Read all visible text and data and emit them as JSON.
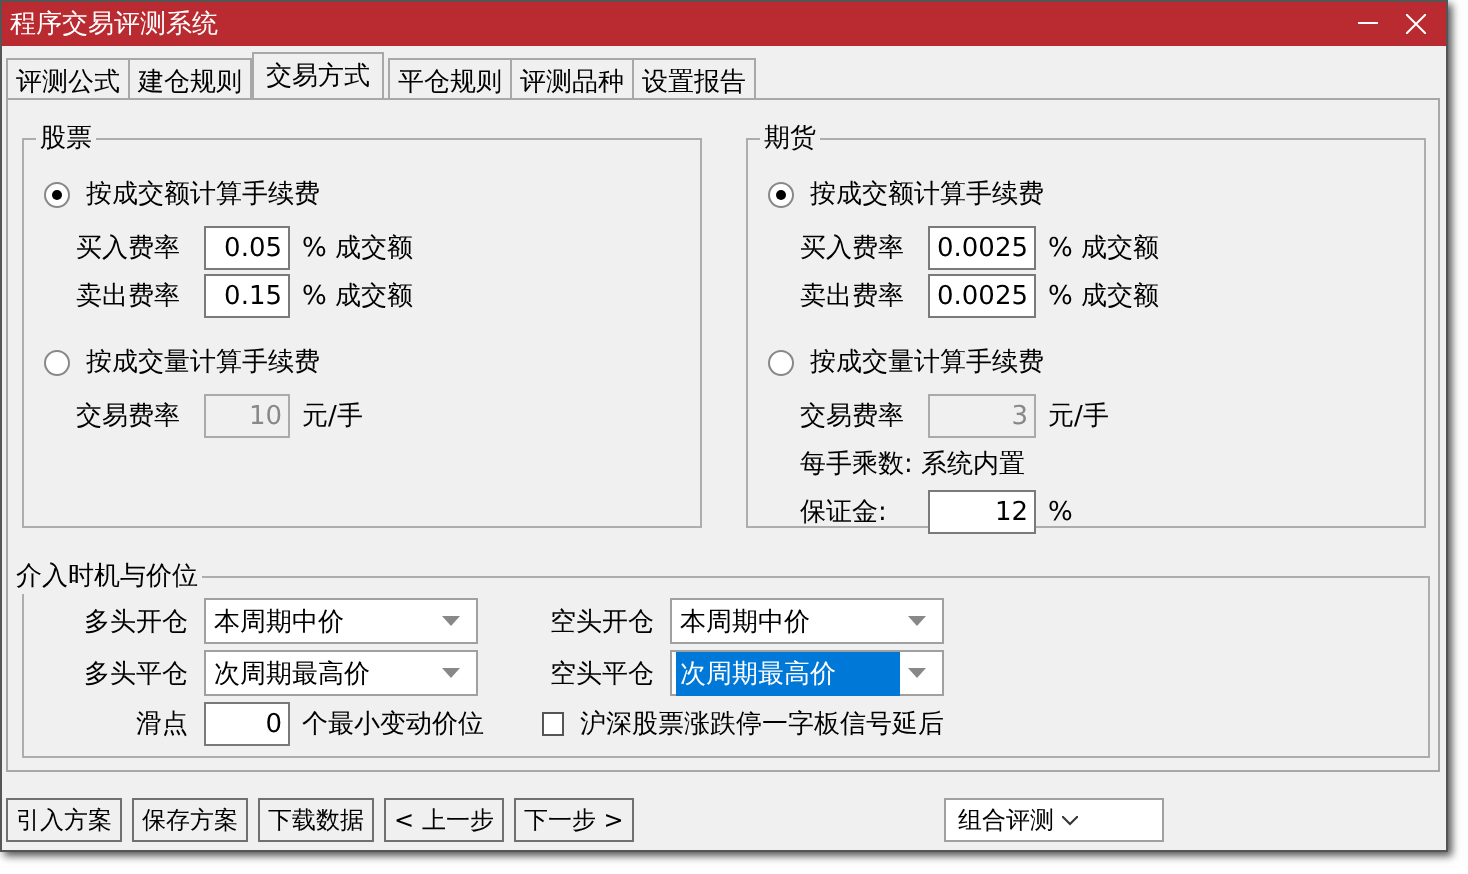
{
  "window": {
    "title": "程序交易评测系统"
  },
  "tabs": [
    {
      "label": "评测公式",
      "selected": false
    },
    {
      "label": "建仓规则",
      "selected": false
    },
    {
      "label": "交易方式",
      "selected": true
    },
    {
      "label": "平仓规则",
      "selected": false
    },
    {
      "label": "评测品种",
      "selected": false
    },
    {
      "label": "设置报告",
      "selected": false
    }
  ],
  "groups": [
    {
      "title": "股票",
      "rows": [
        {
          "kind": "radio",
          "label": "按成交额计算手续费",
          "selected": true
        },
        {
          "kind": "field",
          "label": "买入费率",
          "value": "0.05",
          "unit": "% 成交额",
          "disabled": false
        },
        {
          "kind": "field",
          "label": "卖出费率",
          "value": "0.15",
          "unit": "% 成交额",
          "disabled": false
        },
        {
          "kind": "radio",
          "label": "按成交量计算手续费",
          "selected": false
        },
        {
          "kind": "field",
          "label": "交易费率",
          "value": "10",
          "unit": "元/手",
          "disabled": true
        }
      ]
    },
    {
      "title": "期货",
      "rows": [
        {
          "kind": "radio",
          "label": "按成交额计算手续费",
          "selected": true
        },
        {
          "kind": "field",
          "label": "买入费率",
          "value": "0.0025",
          "unit": "% 成交额",
          "disabled": false
        },
        {
          "kind": "field",
          "label": "卖出费率",
          "value": "0.0025",
          "unit": "% 成交额",
          "disabled": false
        },
        {
          "kind": "radio",
          "label": "按成交量计算手续费",
          "selected": false
        },
        {
          "kind": "field",
          "label": "交易费率",
          "value": "3",
          "unit": "元/手",
          "disabled": true
        },
        {
          "kind": "note",
          "label": "每手乘数: 系统内置"
        },
        {
          "kind": "field",
          "label": "保证金:",
          "value": "12",
          "unit": "%",
          "disabled": false
        }
      ]
    }
  ],
  "timing": {
    "title": "介入时机与价位",
    "selects": [
      {
        "label": "多头开仓",
        "value": "本周期中价",
        "selected": false
      },
      {
        "label": "空头开仓",
        "value": "本周期中价",
        "selected": false
      },
      {
        "label": "多头平仓",
        "value": "次周期最高价",
        "selected": false
      },
      {
        "label": "空头平仓",
        "value": "次周期最高价",
        "selected": true
      }
    ],
    "slippage": {
      "label": "滑点",
      "value": "0",
      "unit": "个最小变动价位"
    },
    "checkbox": {
      "label": "沪深股票涨跌停一字板信号延后",
      "checked": false
    }
  },
  "buttons": [
    "引入方案",
    "保存方案",
    "下载数据",
    "< 上一步",
    "下一步 >"
  ],
  "combo": {
    "value": "组合评测"
  }
}
